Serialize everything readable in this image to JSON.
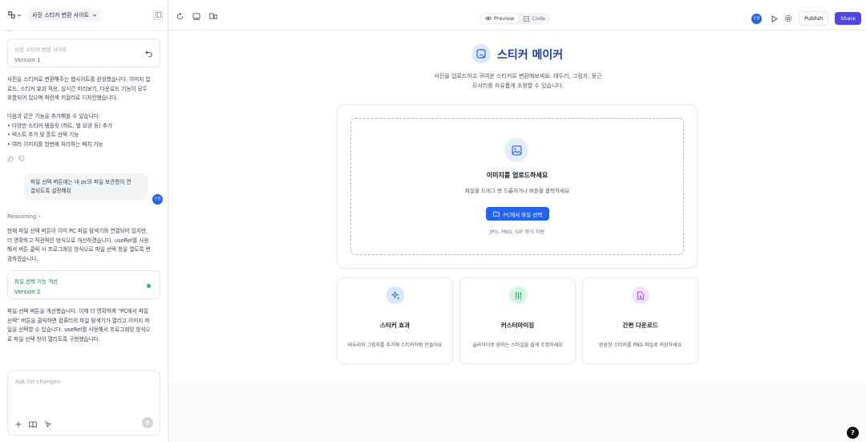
{
  "sidebar": {
    "project_name": "사진 스티커 변환 사이트",
    "cut_text": "...",
    "version1": {
      "title": "사진 스티커 변환 사이트",
      "label": "Version 1"
    },
    "message1": [
      "사진을 스티커로 변환해주는 웹사이트를 완성했습니다. 이미지 업",
      "로드, 스티커 효과 적용, 실시간 미리보기, 다운로드 기능이 모두",
      "포함되어 있으며 파란색 키컬러로 디자인했습니다.",
      "",
      "다음과 같은 기능을 추가해볼 수 있습니다:",
      "• 다양한 스티커 템플릿 (하트, 별 모양 등) 추가",
      "• 텍스트 추가 및 폰트 선택 기능",
      "• 여러 이미지를 한번에 처리하는 배치 기능"
    ],
    "user_message": [
      "파일 선택 버튼에는 내 pc의 파일 보관함이 연",
      "결되도록 설정해줘"
    ],
    "user_initial": "은현",
    "reasoning_label": "Reasoning",
    "message2": [
      "현재 파일 선택 버튼이 이미 PC 파일 탐색기와 연결되어 있지만,",
      "더 명확하고 직관적인 방식으로 개선하겠습니다. useRef를 사용",
      "해서 버튼 클릭 시 프로그래밍 방식으로 파일 선택 창을 열도록 변",
      "경하겠습니다."
    ],
    "version2": {
      "title": "파일 선택 기능 개선",
      "label": "Version 2"
    },
    "message3": [
      "파일 선택 버튼을 개선했습니다. 이제 더 명확하게 \"PC에서 파일",
      "선택\" 버튼을 클릭하면 컴퓨터의 파일 탐색기가 열리고 이미지 파",
      "일을 선택할 수 있습니다. useRef를 사용해서 프로그래밍 방식으",
      "로 파일 선택 창이 열리도록 구현했습니다."
    ],
    "composer_placeholder": "Ask for changes"
  },
  "topbar": {
    "preview_label": "Preview",
    "code_label": "Code",
    "user_initial": "은현",
    "publish_label": "Publish",
    "share_label": "Share"
  },
  "app": {
    "title": "스티커 메이커",
    "subtitle": [
      "사진을 업로드하고 귀여운 스티커로 변환해보세요. 테두리, 그림자, 둥근",
      "모서리를 자유롭게 조정할 수 있습니다."
    ],
    "upload": {
      "title": "이미지를 업로드하세요",
      "subtitle": "파일을 드래그 앤 드롭하거나 버튼을 클릭하세요",
      "button": "PC에서 파일 선택",
      "formats": "JPG, PNG, GIF 형식 지원"
    },
    "features": [
      {
        "title": "스티커 효과",
        "desc": "테두리와 그림자를 추가해 스티커처럼 만들어요"
      },
      {
        "title": "커스터마이징",
        "desc": "슬라이더로 원하는 스타일을 쉽게 조정하세요"
      },
      {
        "title": "간편 다운로드",
        "desc": "완성된 스티커를 PNG 파일로 저장하세요"
      }
    ]
  },
  "help_label": "?",
  "colors": {
    "accent": "#2563eb",
    "share": "#4f46e5",
    "version_green": "#15803d"
  }
}
